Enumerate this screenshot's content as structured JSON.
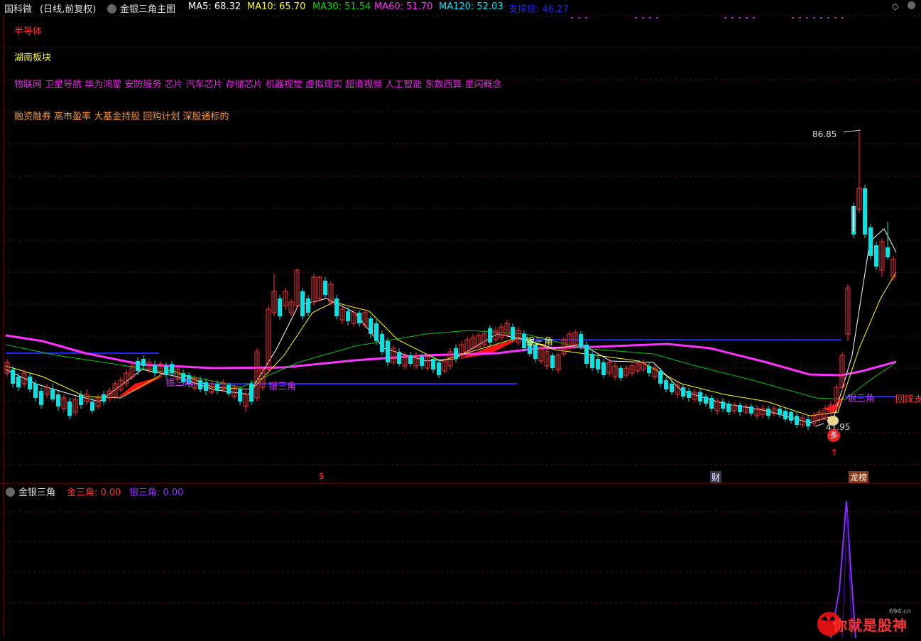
{
  "header": {
    "stock_name": "国科微",
    "period": "(日线,前复权)",
    "indicator_name": "金银三角主图",
    "ma": [
      {
        "label": "MA5: 68.32",
        "color": "#ffffff"
      },
      {
        "label": "MA10: 65.70",
        "color": "#ffff00"
      },
      {
        "label": "MA30: 51.54",
        "color": "#00dd00"
      },
      {
        "label": "MA60: 51.70",
        "color": "#ff33ff"
      },
      {
        "label": "MA120: 52.03",
        "color": "#00e5ff"
      }
    ],
    "support_label": "支撑位: 46.27",
    "support_color": "#2222ff"
  },
  "tags": {
    "industry": "半导体",
    "region": "湖南板块",
    "concepts": "物联网 卫星导航 华为鸿蒙 安防服务 芯片 汽车芯片 存储芯片 机器视觉 虚拟现实 超清视频 人工智能 东数西算 星闪概念",
    "features": "融资融券 高市盈率 大基金持股 回购计划 深股通标的"
  },
  "annotations": {
    "high_price": "86.85",
    "low_price": "41.95",
    "silver_triangle": "银三角",
    "callback_support": "回踩支",
    "buy_marker": "多",
    "event_s": "$",
    "event_finance": "财",
    "event_dragon": "龙榜"
  },
  "sub_panel": {
    "title": "金银三角",
    "gold_label": "金三角: 0.00",
    "silver_label": "银三角: 0.00"
  },
  "watermark": {
    "text": "你就是股神",
    "site": "694.cn"
  },
  "chart_data": {
    "type": "candlestick",
    "y_range_approx": [
      40,
      90
    ],
    "high": 86.85,
    "low": 41.95,
    "support": 46.27,
    "colors": {
      "up": "#ff3333",
      "down": "#00e5e5",
      "ma5": "#ffffff",
      "ma10": "#ffff00",
      "ma30": "#00cc00",
      "ma60": "#ff33ff",
      "support_line": "#2222ff"
    }
  }
}
